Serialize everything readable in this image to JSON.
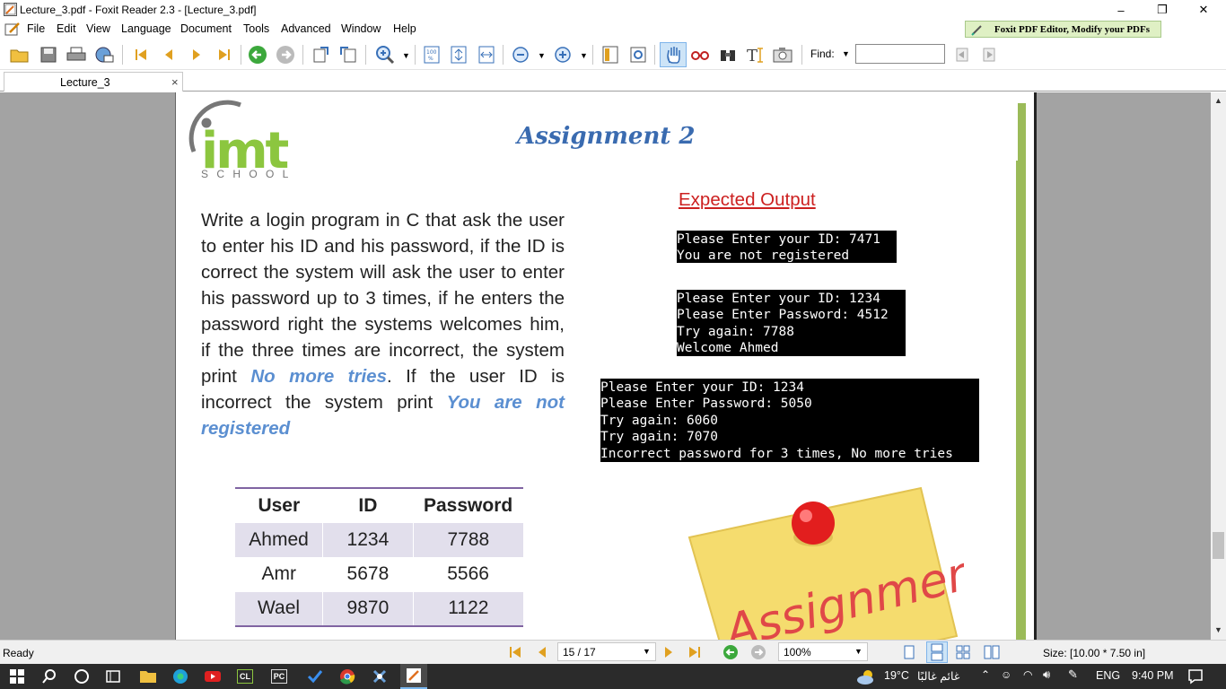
{
  "window": {
    "title": "Lecture_3.pdf - Foxit Reader 2.3 - [Lecture_3.pdf]",
    "controls": [
      "–",
      "❐",
      "✕"
    ]
  },
  "menu": {
    "items": [
      "File",
      "Edit",
      "View",
      "Language",
      "Document",
      "Tools",
      "Advanced",
      "Window",
      "Help"
    ],
    "promo": "Foxit PDF Editor, Modify your PDFs"
  },
  "toolbar": {
    "find_label": "Find:",
    "find_value": ""
  },
  "tab": {
    "label": "Lecture_3",
    "close": "×"
  },
  "slide": {
    "logo_text": "imt",
    "logo_sub": "S C H O O L",
    "title": "Assignment 2",
    "expected_output_label": "Expected Output",
    "body_parts": {
      "p1": "Write a login program in C that ask the user to enter his ID and his password, if the ID is correct the system will ask the user to enter his password up to 3 times, if he enters the password right the systems welcomes him, if the three times are incorrect, the system print ",
      "h1": "No more tries",
      "p2": ". If the user ID is incorrect the system print ",
      "h2": "You are not registered"
    },
    "console1": "Please Enter your ID: 7471\nYou are not registered",
    "console2": "Please Enter your ID: 1234\nPlease Enter Password: 4512\nTry again: 7788\nWelcome Ahmed",
    "console3": "Please Enter your ID: 1234\nPlease Enter Password: 5050\nTry again: 6060\nTry again: 7070\nIncorrect password for 3 times, No more tries",
    "table": {
      "headers": [
        "User",
        "ID",
        "Password"
      ],
      "rows": [
        [
          "Ahmed",
          "1234",
          "7788"
        ],
        [
          "Amr",
          "5678",
          "5566"
        ],
        [
          "Wael",
          "9870",
          "1122"
        ]
      ]
    },
    "sticky_note_text": "Assignment"
  },
  "status": {
    "left": "Ready",
    "page": "15 / 17",
    "zoom": "100%",
    "size": "Size: [10.00 * 7.50 in]"
  },
  "taskbar": {
    "weather": "19°C",
    "weather_desc": "غائم غالبًا",
    "lang": "ENG",
    "time": "9:40 PM"
  },
  "colors": {
    "accent_blue": "#5b8fd1",
    "logo_green": "#8cc63f",
    "expected_red": "#cc1f1f",
    "table_row": "#e2dfec",
    "table_line": "#8064a2",
    "side_bar_green": "#9bbb59"
  }
}
